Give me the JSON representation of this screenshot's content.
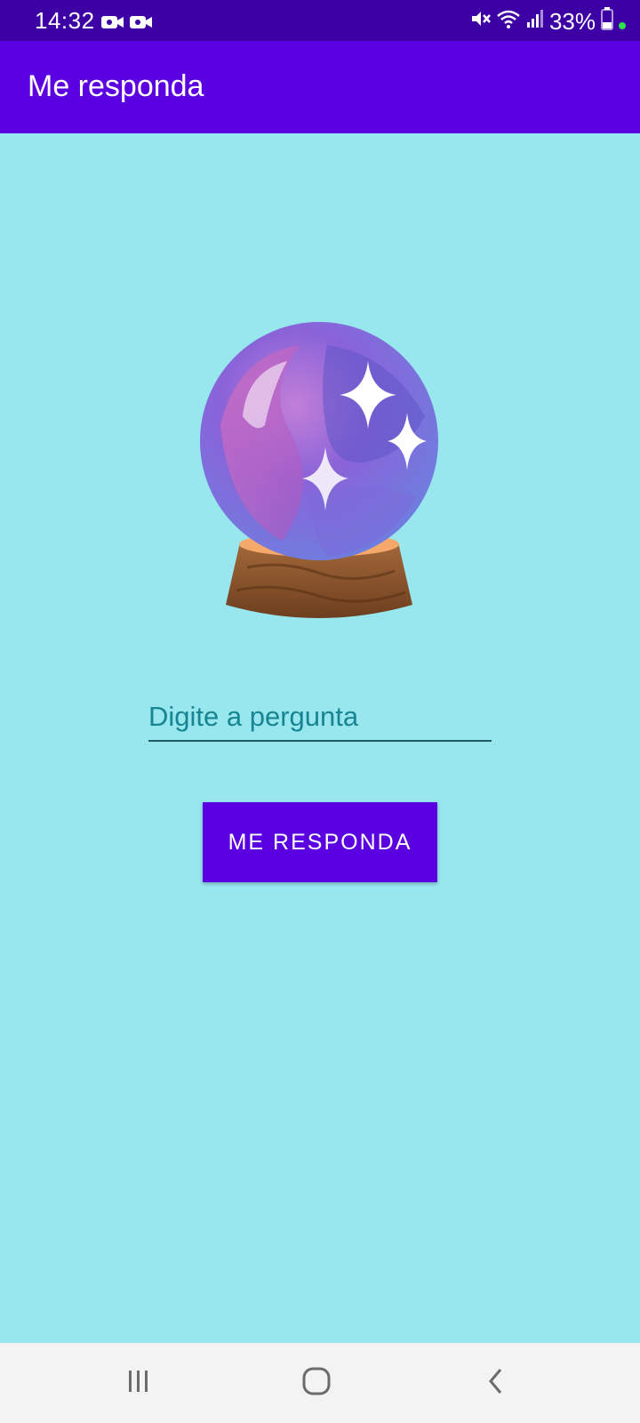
{
  "status_bar": {
    "time": "14:32",
    "battery": "33%",
    "left_icons": [
      "video-camera-icon",
      "video-camera-icon"
    ],
    "right_icons": [
      "mute-icon",
      "wifi-icon",
      "signal-icon",
      "battery-icon",
      "dot-icon"
    ]
  },
  "app_bar": {
    "title": "Me responda"
  },
  "main": {
    "image": "crystal-ball",
    "question_input": {
      "value": "",
      "placeholder": "Digite a pergunta"
    },
    "answer_button": {
      "label": "ME RESPONDA"
    }
  },
  "nav_bar": {
    "items": [
      "recent-apps-icon",
      "home-icon",
      "back-icon"
    ]
  },
  "colors": {
    "status_bar": "#3d00a5",
    "app_bar": "#5b00e0",
    "background": "#98e6ee",
    "button": "#5b00e0",
    "placeholder": "#178692",
    "nav_bar": "#f3f3f3",
    "notification_dot": "#2ee44b"
  }
}
